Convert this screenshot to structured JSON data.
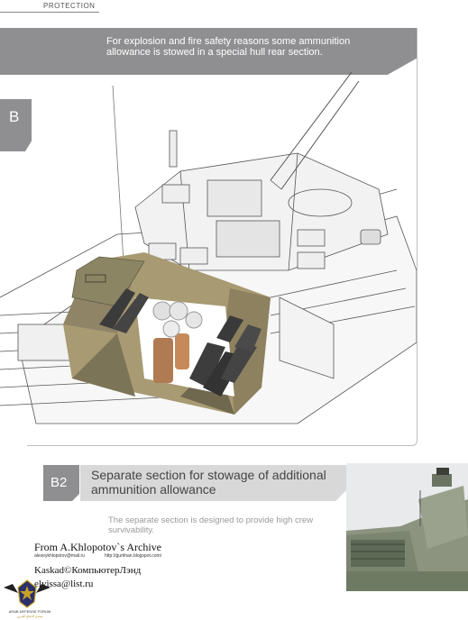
{
  "header": {
    "label": "PROTECTION"
  },
  "callout": {
    "text": "For explosion and fire safety reasons some ammunition allowance is stowed in a special hull rear section."
  },
  "section": {
    "tab_label": "B"
  },
  "subsection": {
    "code": "B2",
    "title": "Separate section for stowage of additional ammunition allowance",
    "body": "The separate section is designed to provide high crew survivability."
  },
  "credits": {
    "archive": "From A.Khlopotov`s Archive",
    "archive_email": "alexeykhlopotov@mail.ru",
    "archive_url": "http://gurkhan.blogspot.com/",
    "line2": "Kaskad©КомпьютерЛэнд",
    "line3": "elvissa@list.ru"
  },
  "logo": {
    "name": "ARAB DEFENSE FORUM",
    "tagline": "منتدى الدفاع العربي"
  },
  "colors": {
    "accent_gray": "#8f8f91",
    "light_gray": "#d8d8d9",
    "camo_tan": "#a89a72",
    "camo_olive": "#7c7456"
  }
}
